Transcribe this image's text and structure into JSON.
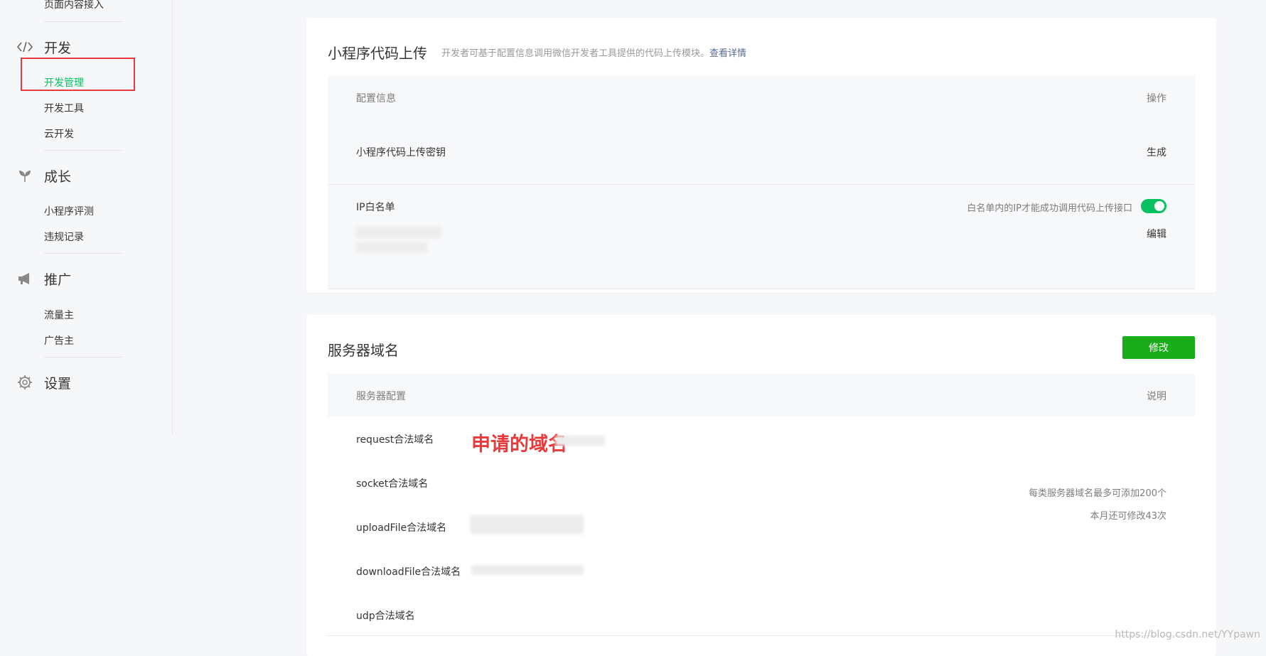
{
  "sidebar": {
    "top_item": "页面内容接入",
    "groups": [
      {
        "title": "开发",
        "icon": "code-icon",
        "items": [
          "开发管理",
          "开发工具",
          "云开发"
        ]
      },
      {
        "title": "成长",
        "icon": "sprout-icon",
        "items": [
          "小程序评测",
          "违规记录"
        ]
      },
      {
        "title": "推广",
        "icon": "megaphone-icon",
        "items": [
          "流量主",
          "广告主"
        ]
      },
      {
        "title": "设置",
        "icon": "gear-icon",
        "items": []
      }
    ],
    "active_item": "开发管理"
  },
  "upload_card": {
    "title": "小程序代码上传",
    "desc": "开发者可基于配置信息调用微信开发者工具提供的代码上传模块。",
    "desc_link": "查看详情",
    "header_left": "配置信息",
    "header_right": "操作",
    "key_row": {
      "label": "小程序代码上传密钥",
      "action": "生成"
    },
    "ip_row": {
      "label": "IP白名单",
      "hint": "白名单内的IP才能成功调用代码上传接口",
      "toggle_on": true,
      "action": "编辑"
    }
  },
  "server_card": {
    "title": "服务器域名",
    "edit_button": "修改",
    "header_left": "服务器配置",
    "header_right": "说明",
    "rows": [
      {
        "label": "request合法域名"
      },
      {
        "label": "socket合法域名"
      },
      {
        "label": "uploadFile合法域名"
      },
      {
        "label": "downloadFile合法域名"
      },
      {
        "label": "udp合法域名"
      }
    ],
    "note_line1": "每类服务器域名最多可添加200个",
    "note_line2": "本月还可修改43次",
    "annotation": "申请的域名"
  },
  "watermark": "https://blog.csdn.net/YYpawn",
  "colors": {
    "accent_green": "#07c160",
    "button_green": "#1aad19",
    "link_blue": "#576b95",
    "annotation_red": "#e83a3a"
  }
}
